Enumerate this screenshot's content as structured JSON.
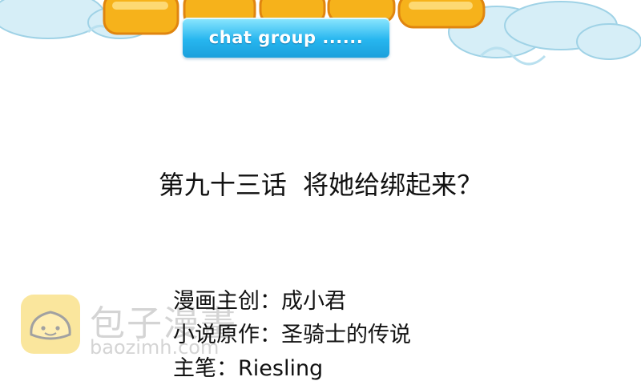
{
  "banner": {
    "title_art": "decorative-title-logo",
    "subtitle": "chat group ......",
    "colors": {
      "cloud": "#d6eef7",
      "title": "#f6b21b",
      "plate": "#27b6ef"
    }
  },
  "chapter": {
    "title": "第九十三话  将她给绑起来？"
  },
  "credits": [
    {
      "label": "漫画主创：成小君"
    },
    {
      "label": "小说原作：圣骑士的传说"
    },
    {
      "label": "主笔：Riesling"
    }
  ],
  "watermark": {
    "cn": "包子漫畫",
    "url": "baozimh.com",
    "logo_color": "#f5c518"
  }
}
